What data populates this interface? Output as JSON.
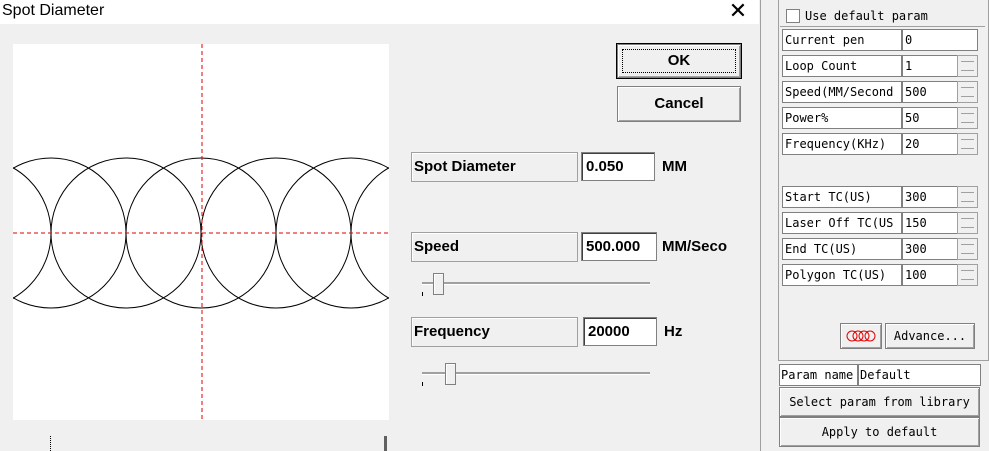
{
  "dialog": {
    "title": "Spot Diameter",
    "ok_label": "OK",
    "cancel_label": "Cancel",
    "spot_diameter": {
      "label": "Spot Diameter",
      "value": "0.050",
      "unit": "MM"
    },
    "speed": {
      "label": "Speed",
      "value": "500.000",
      "unit": "MM/Seco",
      "slider_level": 0.06
    },
    "frequency": {
      "label": "Frequency",
      "value": "20000",
      "unit": "Hz",
      "slider_level": 0.12
    }
  },
  "param_panel": {
    "use_default_label": "Use default param",
    "rows": [
      {
        "label": "Current pen",
        "value": "0"
      },
      {
        "label": "Loop Count",
        "value": "1"
      },
      {
        "label": "Speed(MM/Second",
        "value": "500"
      },
      {
        "label": "Power%",
        "value": "50"
      },
      {
        "label": "Frequency(KHz)",
        "value": "20"
      },
      {
        "label": "Start TC(US)",
        "value": "300"
      },
      {
        "label": "Laser Off TC(US",
        "value": "150"
      },
      {
        "label": "End TC(US)",
        "value": "300"
      },
      {
        "label": "Polygon TC(US)",
        "value": "100"
      }
    ],
    "advance_label": "Advance...",
    "param_name_label": "Param name",
    "param_name_value": "Default",
    "select_library_label": "Select param from library",
    "apply_default_label": "Apply to default"
  }
}
